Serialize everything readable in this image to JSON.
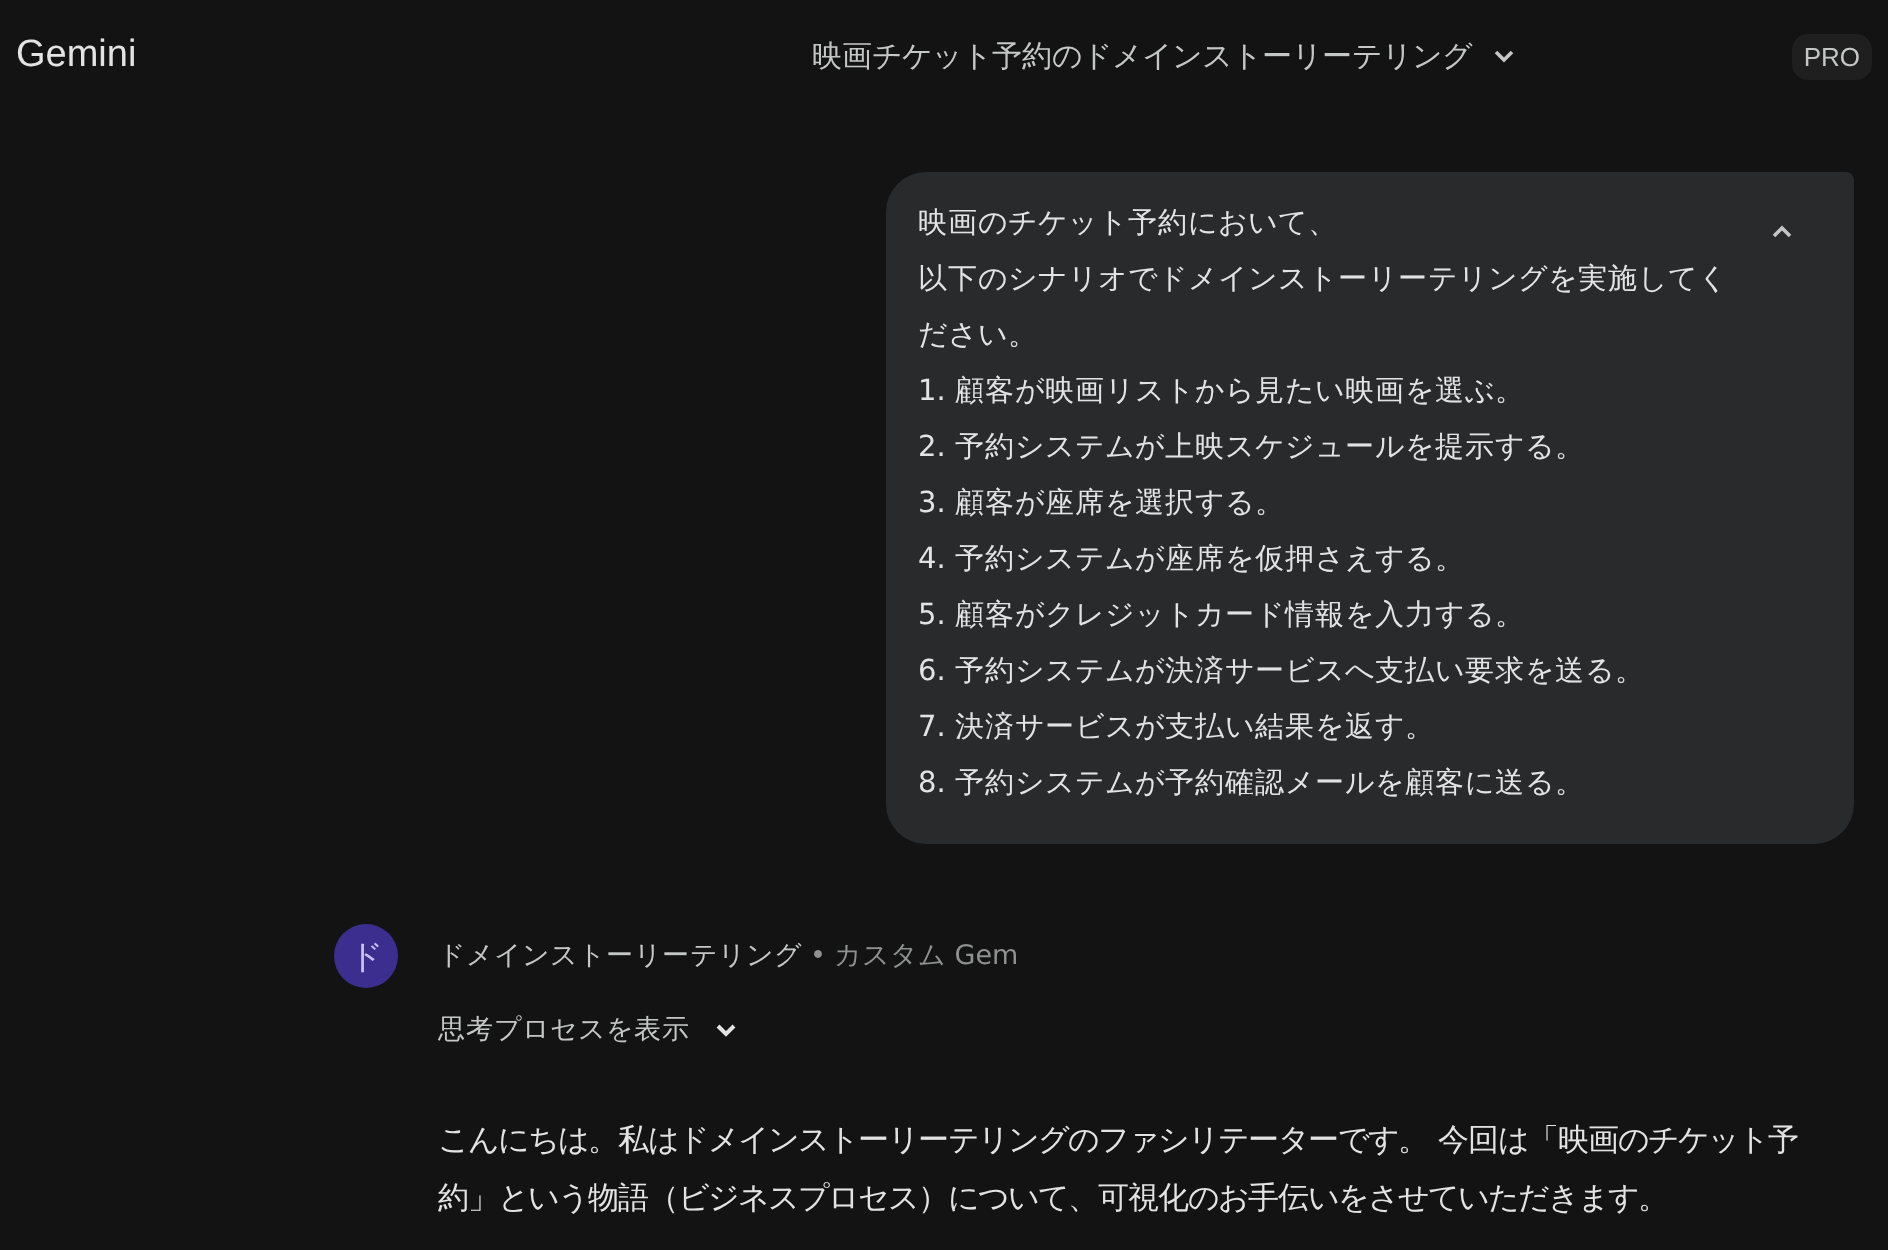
{
  "app": {
    "name": "Gemini",
    "badge": "PRO"
  },
  "conversation": {
    "title": "映画チケット予約のドメインストーリーテリング"
  },
  "user_message": {
    "expanded": true,
    "lines": [
      "映画のチケット予約において、",
      "以下のシナリオでドメインストーリーテリングを実施してください。",
      "1. 顧客が映画リストから見たい映画を選ぶ。",
      "2. 予約システムが上映スケジュールを提示する。",
      "3. 顧客が座席を選択する。",
      "4. 予約システムが座席を仮押さえする。",
      "5. 顧客がクレジットカード情報を入力する。",
      "6. 予約システムが決済サービスへ支払い要求を送る。",
      "7. 決済サービスが支払い結果を返す。",
      "8. 予約システムが予約確認メールを顧客に送る。"
    ]
  },
  "response": {
    "avatar": "ド",
    "gem_name": "ドメインストーリーテリング",
    "separator": "•",
    "gem_kind": "カスタム Gem",
    "thinking_toggle": {
      "label": "思考プロセスを表示",
      "expanded": false
    },
    "text": "こんにちは。私はドメインストーリーテリングのファシリテーターです。 今回は「映画のチケット予約」という物語（ビジネスプロセス）について、可視化のお手伝いをさせていただきます。"
  }
}
